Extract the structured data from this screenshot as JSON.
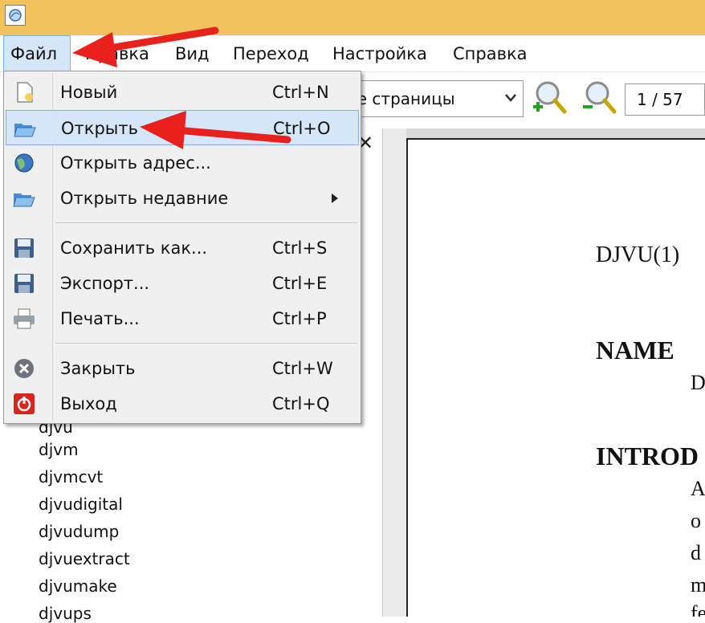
{
  "menubar": {
    "items": [
      "Файл",
      "Правка",
      "Вид",
      "Переход",
      "Настройка",
      "Справка"
    ]
  },
  "toolbar": {
    "zoom_select_value": "ирине страницы",
    "page_indicator": "1 / 57"
  },
  "file_menu": {
    "items": [
      {
        "label": "Новый",
        "shortcut": "Ctrl+N",
        "icon": "new-file-icon"
      },
      {
        "label": "Открыть",
        "shortcut": "Ctrl+O",
        "icon": "open-folder-icon"
      },
      {
        "label": "Открыть адрес...",
        "shortcut": "",
        "icon": "globe-icon"
      },
      {
        "label": "Открыть недавние",
        "shortcut": "",
        "icon": "open-folder-icon"
      },
      {
        "label": "Сохранить как...",
        "shortcut": "Ctrl+S",
        "icon": "save-disk-icon"
      },
      {
        "label": "Экспорт...",
        "shortcut": "Ctrl+E",
        "icon": "save-disk-icon"
      },
      {
        "label": "Печать...",
        "shortcut": "Ctrl+P",
        "icon": "printer-icon"
      },
      {
        "label": "Закрыть",
        "shortcut": "Ctrl+W",
        "icon": "close-circle-icon"
      },
      {
        "label": "Выход",
        "shortcut": "Ctrl+Q",
        "icon": "power-icon"
      }
    ]
  },
  "file_list": {
    "partial_top": "djvu",
    "items": [
      "djvm",
      "djvmcvt",
      "djvudigital",
      "djvudump",
      "djvuextract",
      "djvumake",
      "djvups"
    ]
  },
  "document": {
    "header": "DJVU(1)",
    "section_name": "NAME",
    "name_fragment": "D",
    "section_intro": "INTROD",
    "intro_lines": [
      "A",
      "o",
      "d",
      "m",
      "fe"
    ]
  },
  "colors": {
    "titlebar": "#f2c25e",
    "highlight": "#d5e6f8",
    "highlight_border": "#7eb1e3",
    "annotation_arrow": "#e8211d"
  }
}
